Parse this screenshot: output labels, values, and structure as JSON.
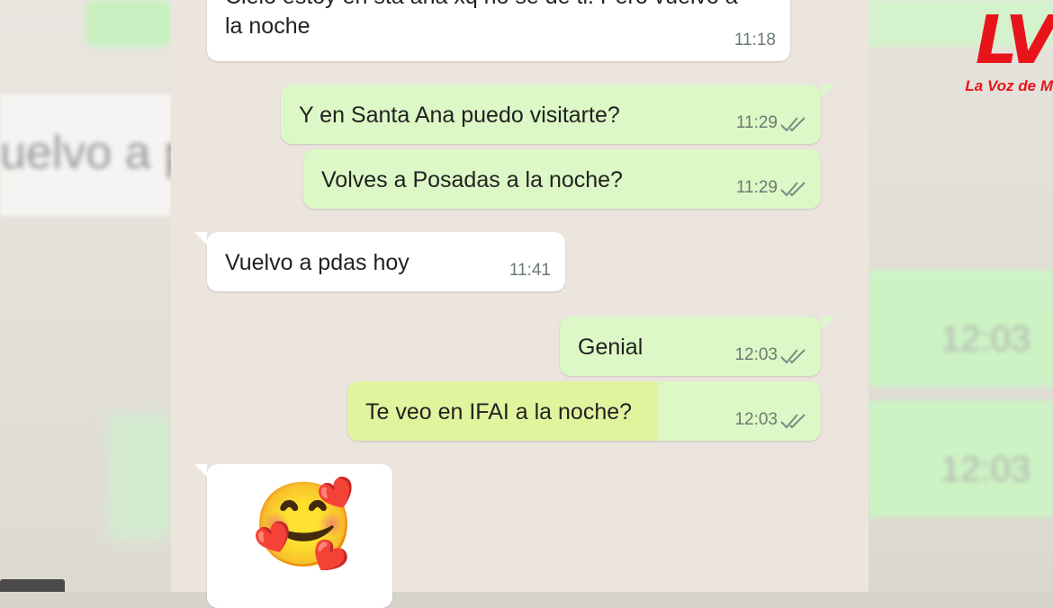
{
  "logo": {
    "mark": "LV",
    "subtitle": "La Voz de M"
  },
  "messages": [
    {
      "dir": "in",
      "text_line1": "Cielo estoy en sta ana xq no se de ti. Pero vuelvo a",
      "text_line2": "la noche",
      "time": "11:18"
    },
    {
      "dir": "out",
      "text": "Y en Santa Ana puedo visitarte?",
      "time": "11:29"
    },
    {
      "dir": "out",
      "text": "Volves a Posadas a la noche?",
      "time": "11:29"
    },
    {
      "dir": "in",
      "text": "Vuelvo a pdas hoy",
      "time": "11:41"
    },
    {
      "dir": "out",
      "text": "Genial",
      "time": "12:03"
    },
    {
      "dir": "out",
      "text": "Te veo en IFAI a la noche?",
      "time": "12:03",
      "highlighted": true
    },
    {
      "dir": "in",
      "emoji": "🥰"
    }
  ],
  "background": {
    "left_blur_text": "uelvo a pd",
    "right_blur_times": [
      "12:03",
      "12:03"
    ]
  },
  "colors": {
    "incoming_bubble": "#ffffff",
    "outgoing_bubble": "#dcf8c6",
    "highlight": "#e2f39e",
    "chat_background": "#ebe5de",
    "logo_red": "#e8141c",
    "read_ticks": "#7a8a82"
  }
}
